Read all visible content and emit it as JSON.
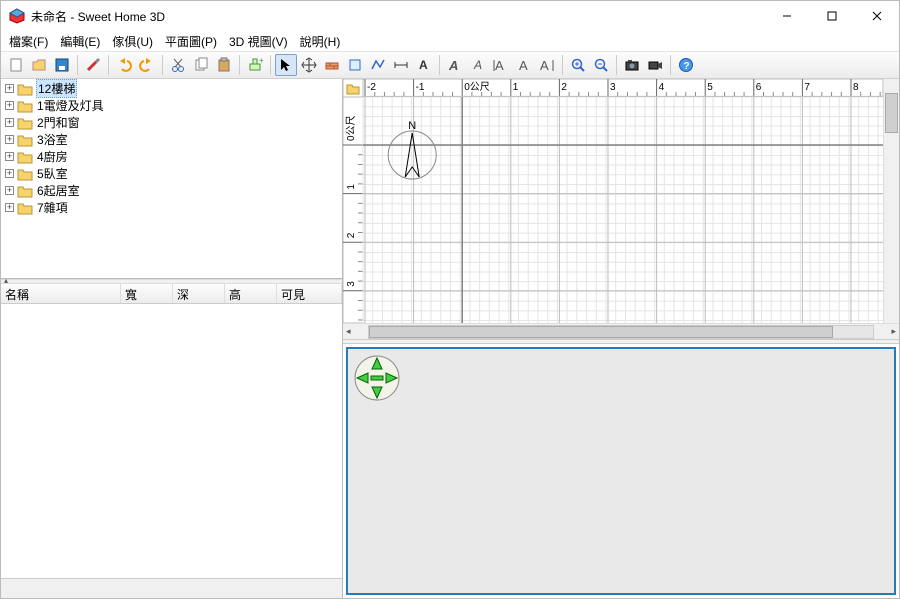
{
  "title": "未命名 - Sweet Home 3D",
  "menus": [
    "檔案(F)",
    "編輯(E)",
    "傢俱(U)",
    "平面圖(P)",
    "3D 視圖(V)",
    "說明(H)"
  ],
  "toolbar_icons": [
    "new-icon",
    "open-icon",
    "save-icon",
    "sep",
    "preferences-icon",
    "sep",
    "undo-icon",
    "redo-icon",
    "sep",
    "cut-icon",
    "copy-icon",
    "paste-icon",
    "sep",
    "add-furniture-icon",
    "sep",
    "select-icon",
    "pan-icon",
    "create-walls-icon",
    "create-rooms-icon",
    "create-polylines-icon",
    "create-dimensions-icon",
    "create-text-icon",
    "sep",
    "text-bold-icon",
    "text-italic-icon",
    "text-align-left-icon",
    "text-align-center-icon",
    "text-align-right-icon",
    "sep",
    "zoom-in-icon",
    "zoom-out-icon",
    "sep",
    "take-photo-icon",
    "create-video-icon",
    "sep",
    "help-icon"
  ],
  "catalog": [
    {
      "label": "12樓梯",
      "selected": true
    },
    {
      "label": "1電燈及灯具"
    },
    {
      "label": "2門和窗"
    },
    {
      "label": "3浴室"
    },
    {
      "label": "4廚房"
    },
    {
      "label": "5臥室"
    },
    {
      "label": "6起居室"
    },
    {
      "label": "7雜項"
    }
  ],
  "furniture_cols": {
    "c1": "名稱",
    "c2": "寬",
    "c3": "深",
    "c4": "高",
    "c5": "可見"
  },
  "ruler_unit": "0公尺",
  "ruler_h": [
    "-2",
    "-1",
    "0公尺",
    "1",
    "2",
    "3",
    "4",
    "5",
    "6",
    "7",
    "8"
  ],
  "ruler_v": [
    "0公尺",
    "1",
    "2",
    "3"
  ],
  "compass": "N"
}
